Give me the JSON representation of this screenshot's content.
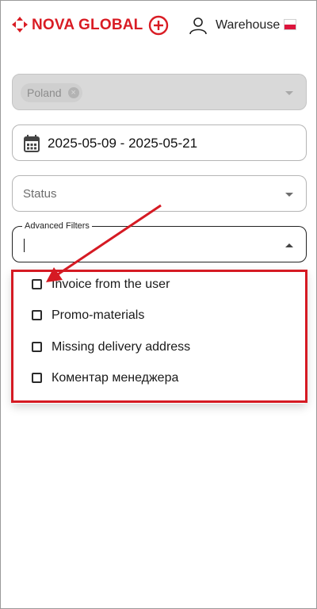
{
  "header": {
    "brand": "NOVA GLOBAL",
    "warehouse_label": "Warehouse",
    "brand_color": "#d91c24",
    "icons": [
      "logo-mark-icon",
      "plus-circle-icon",
      "user-icon",
      "flag-poland-icon"
    ]
  },
  "filters": {
    "country_chip": "Poland",
    "date_range": "2025-05-09 - 2025-05-21",
    "status_placeholder": "Status",
    "advanced_legend": "Advanced Filters"
  },
  "dropdown": {
    "options": [
      {
        "label": "Invoice from the user",
        "checked": false
      },
      {
        "label": "Promo-materials",
        "checked": false
      },
      {
        "label": "Missing delivery address",
        "checked": false
      },
      {
        "label": "Коментар менеджера",
        "checked": false
      }
    ],
    "highlight_color": "#d51a23"
  }
}
